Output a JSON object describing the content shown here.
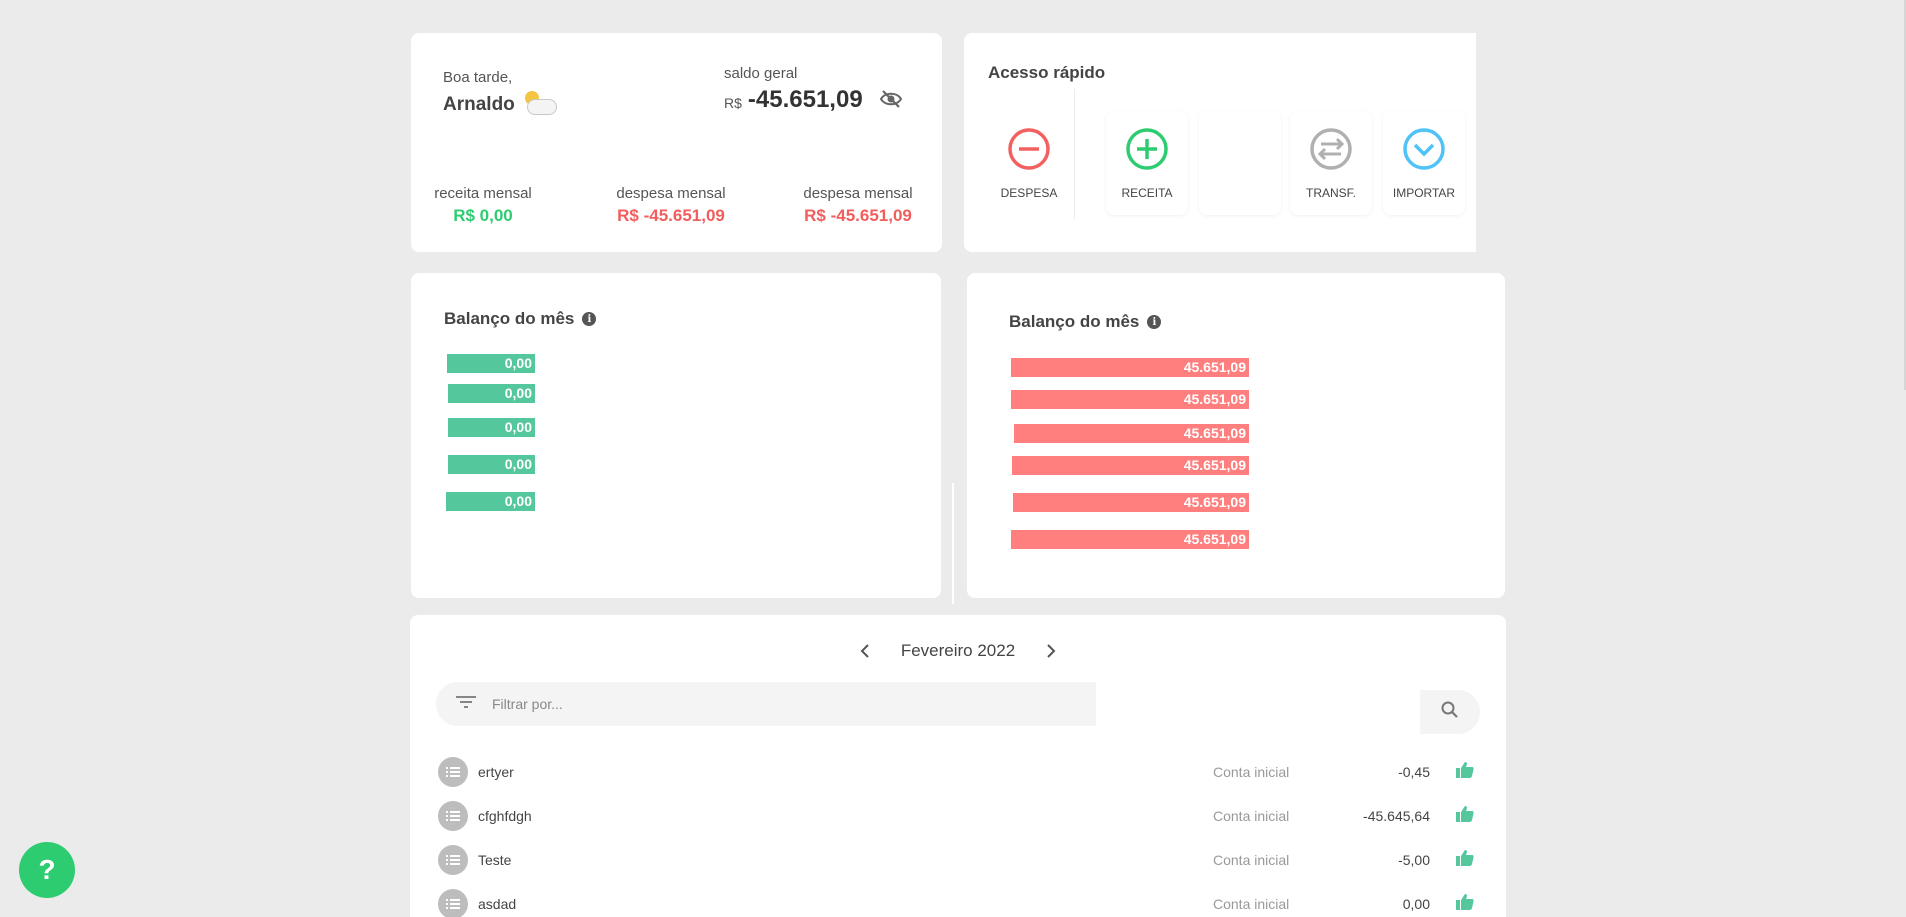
{
  "greeting": {
    "salutation": "Boa tarde,",
    "name": "Arnaldo",
    "weather_icon": "sun-cloud-icon",
    "balance_label": "saldo geral",
    "balance_currency": "R$",
    "balance_value": "-45.651,09",
    "stats": [
      {
        "label": "receita mensal",
        "value": "R$ 0,00",
        "color": "#2ecc71"
      },
      {
        "label": "despesa mensal",
        "value": "R$ -45.651,09",
        "color": "#f25d5d"
      },
      {
        "label": "despesa mensal",
        "value": "R$ -45.651,09",
        "color": "#f25d5d"
      }
    ]
  },
  "quick_access": {
    "title": "Acesso rápido",
    "buttons": [
      {
        "label": "DESPESA",
        "icon": "minus-circle-icon",
        "color": "#f26060"
      },
      {
        "label": "RECEITA",
        "icon": "plus-circle-icon",
        "color": "#2ecc71"
      },
      {
        "label": "TRANSF.",
        "icon": "transfer-circle-icon",
        "color": "#b0b0b0"
      },
      {
        "label": "IMPORTAR",
        "icon": "chevron-down-circle-icon",
        "color": "#4fc3f7"
      }
    ]
  },
  "balance_green": {
    "title": "Balanço do mês",
    "bars": [
      "0,00",
      "0,00",
      "0,00",
      "0,00",
      "0,00"
    ]
  },
  "balance_red": {
    "title": "Balanço do mês",
    "bars": [
      "45.651,09",
      "45.651,09",
      "45.651,09",
      "45.651,09",
      "45.651,09",
      "45.651,09"
    ]
  },
  "transactions": {
    "month": "Fevereiro 2022",
    "filter_placeholder": "Filtrar por...",
    "rows": [
      {
        "name": "ertyer",
        "account": "Conta inicial",
        "value": "-0,45"
      },
      {
        "name": "cfghfdgh",
        "account": "Conta inicial",
        "value": "-45.645,64"
      },
      {
        "name": "Teste",
        "account": "Conta inicial",
        "value": "-5,00"
      },
      {
        "name": "asdad",
        "account": "Conta inicial",
        "value": "0,00"
      }
    ]
  },
  "help": {
    "label": "?"
  },
  "colors": {
    "green": "#55c79d",
    "red": "#ff7f7f",
    "brand": "#2ecc71"
  }
}
